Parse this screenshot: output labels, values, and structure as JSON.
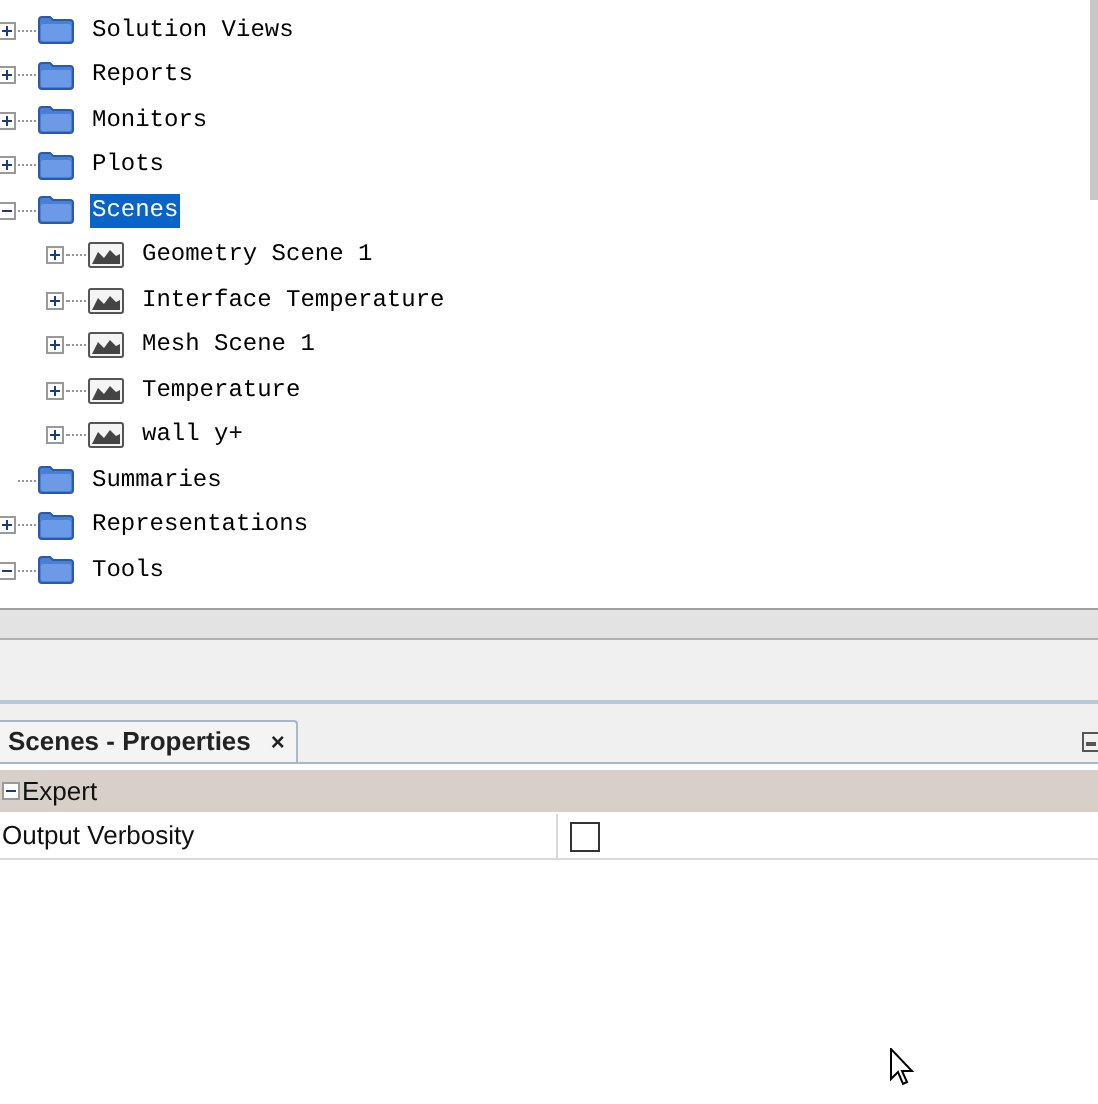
{
  "tree": [
    {
      "label": "Solution Views",
      "kind": "folder",
      "expanded": false,
      "selected": false
    },
    {
      "label": "Reports",
      "kind": "folder",
      "expanded": false,
      "selected": false
    },
    {
      "label": "Monitors",
      "kind": "folder",
      "expanded": false,
      "selected": false
    },
    {
      "label": "Plots",
      "kind": "folder",
      "expanded": false,
      "selected": false
    },
    {
      "label": "Scenes",
      "kind": "folder",
      "expanded": true,
      "selected": true,
      "children": [
        {
          "label": "Geometry Scene 1",
          "kind": "scene",
          "expanded": false,
          "selected": false
        },
        {
          "label": "Interface Temperature",
          "kind": "scene",
          "expanded": false,
          "selected": false
        },
        {
          "label": "Mesh Scene 1",
          "kind": "scene",
          "expanded": false,
          "selected": false
        },
        {
          "label": "Temperature",
          "kind": "scene",
          "expanded": false,
          "selected": false
        },
        {
          "label": "wall y+",
          "kind": "scene",
          "expanded": false,
          "selected": false
        }
      ]
    },
    {
      "label": "Summaries",
      "kind": "folder",
      "selected": false
    },
    {
      "label": "Representations",
      "kind": "folder",
      "expanded": false,
      "selected": false
    },
    {
      "label": "Tools",
      "kind": "folder",
      "expanded": true,
      "selected": false
    }
  ],
  "properties_tab": {
    "title": "Scenes - Properties",
    "close": "×"
  },
  "properties": {
    "category": {
      "label": "Expert",
      "expanded": true
    },
    "rows": [
      {
        "name": "Output Verbosity",
        "kind": "checkbox",
        "checked": false
      }
    ]
  }
}
